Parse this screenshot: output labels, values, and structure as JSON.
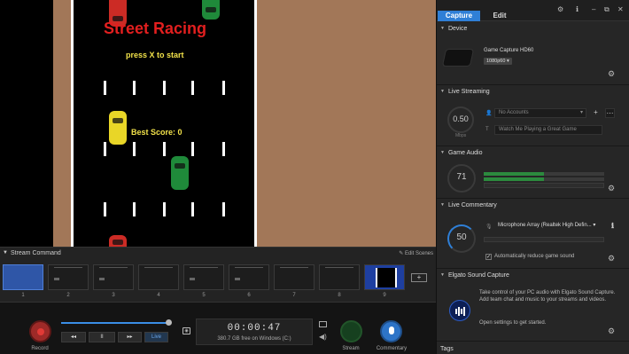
{
  "game": {
    "title": "Street Racing",
    "prompt": "press X to start",
    "best_score": "Best Score: 0"
  },
  "stream_command": {
    "title": "Stream Command",
    "edit_scenes": "Edit Scenes",
    "scenes": [
      "1",
      "2",
      "3",
      "4",
      "5",
      "6",
      "7",
      "8",
      "9"
    ],
    "add_icon": "add-scene-icon"
  },
  "transport": {
    "record_label": "Record",
    "rewind": "◂◂",
    "pause": "II",
    "forward": "▸▸",
    "live": "Live",
    "timecode": "00:00:47",
    "free_space": "380.7 GB free on Windows (C:)",
    "stream_label": "Stream",
    "commentary_label": "Commentary",
    "progress": 1.0
  },
  "right": {
    "tabs": {
      "capture": "Capture",
      "edit": "Edit"
    },
    "device": {
      "header": "Device",
      "name": "Game Capture HD60",
      "resolution": "1080p60 ▾"
    },
    "live_streaming": {
      "header": "Live Streaming",
      "bitrate": "0.50",
      "bitrate_unit": "Mbps",
      "accounts": "No Accounts",
      "title_placeholder": "Watch Me Playing a Great Game"
    },
    "game_audio": {
      "header": "Game Audio",
      "level": "71",
      "meter_level": 0.5
    },
    "live_commentary": {
      "header": "Live Commentary",
      "level": "50",
      "device": "Microphone Array (Realtek High Defin...",
      "auto_reduce": "Automatically reduce game sound",
      "auto_reduce_checked": true
    },
    "sound_capture": {
      "header": "Elgato Sound Capture",
      "desc1": "Take control of your PC audio with Elgato Sound Capture. Add team chat and music to your streams and videos.",
      "desc2": "Open settings to get started."
    },
    "tags": {
      "header": "Tags"
    }
  },
  "colors": {
    "accent": "#2f7fd6",
    "record": "#9e2a28",
    "stream": "#16401f",
    "dirt": "#a27758"
  }
}
